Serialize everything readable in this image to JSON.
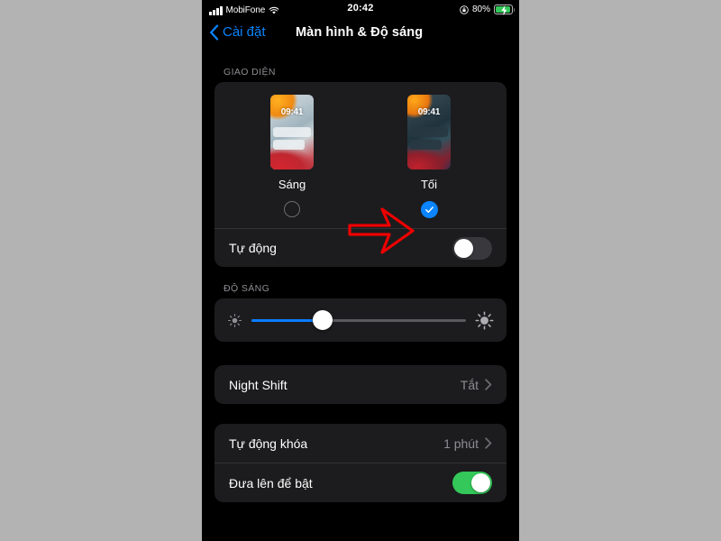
{
  "statusbar": {
    "carrier": "MobiFone",
    "signal_icon": "signal-bars-icon",
    "wifi_icon": "wifi-icon",
    "time": "20:42",
    "lock_icon": "rotation-lock-icon",
    "battery_percent": "80%",
    "battery_icon": "battery-charging-icon",
    "battery_color": "#34c759"
  },
  "navbar": {
    "back_label": "Cài đặt",
    "back_icon": "chevron-left-icon",
    "title": "Màn hình & Độ sáng",
    "accent_color": "#0a84ff"
  },
  "appearance": {
    "section_header": "GIAO DIỆN",
    "modes": [
      {
        "label": "Sáng",
        "clock": "09:41",
        "selected": false
      },
      {
        "label": "Tối",
        "clock": "09:41",
        "selected": true
      }
    ],
    "check_icon": "check-icon",
    "auto_row": {
      "label": "Tự động",
      "toggle_on": false
    }
  },
  "brightness": {
    "section_header": "ĐỘ SÁNG",
    "low_icon": "brightness-low-icon",
    "high_icon": "brightness-high-icon",
    "value_percent": 33,
    "fill_color": "#0a7cff"
  },
  "night_shift": {
    "label": "Night Shift",
    "value": "Tắt",
    "chevron_icon": "chevron-right-icon"
  },
  "lock_section": {
    "rows": [
      {
        "label": "Tự động khóa",
        "value": "1 phút",
        "chevron_icon": "chevron-right-icon"
      }
    ],
    "raise_row": {
      "label": "Đưa lên để bật",
      "toggle_on": true
    }
  },
  "annotation": {
    "arrow_icon": "red-arrow-right-icon",
    "color": "#ee0000"
  }
}
